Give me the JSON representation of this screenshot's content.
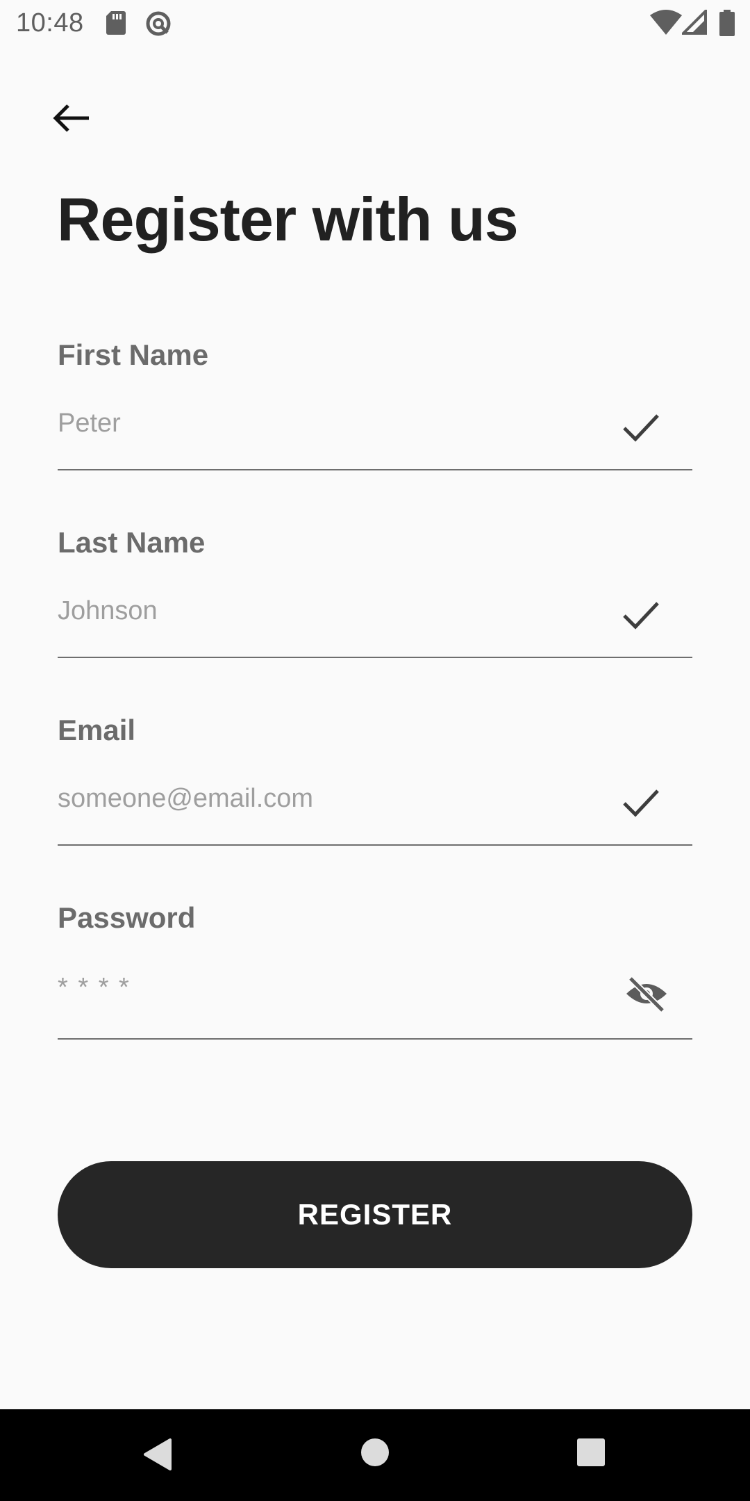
{
  "status_bar": {
    "time": "10:48",
    "icons": [
      "sd-card-icon",
      "data-saver-icon",
      "wifi-icon",
      "signal-icon",
      "battery-icon"
    ]
  },
  "header": {
    "back_icon": "arrow-left-icon",
    "title": "Register with us"
  },
  "form": {
    "fields": [
      {
        "label": "First Name",
        "value": "Peter",
        "status_icon": "check-icon"
      },
      {
        "label": "Last Name",
        "value": "Johnson",
        "status_icon": "check-icon"
      },
      {
        "label": "Email",
        "value": "someone@email.com",
        "status_icon": "check-icon"
      },
      {
        "label": "Password",
        "value": "* * * *",
        "status_icon": "eye-off-icon"
      }
    ],
    "submit_label": "REGISTER"
  },
  "nav_bar": {
    "icons": [
      "back-triangle-icon",
      "home-circle-icon",
      "recents-square-icon"
    ]
  },
  "colors": {
    "background": "#fafafa",
    "title": "#212121",
    "label": "#6b6b6b",
    "value": "#9e9e9e",
    "button": "#262626",
    "nav_bar": "#000000"
  }
}
